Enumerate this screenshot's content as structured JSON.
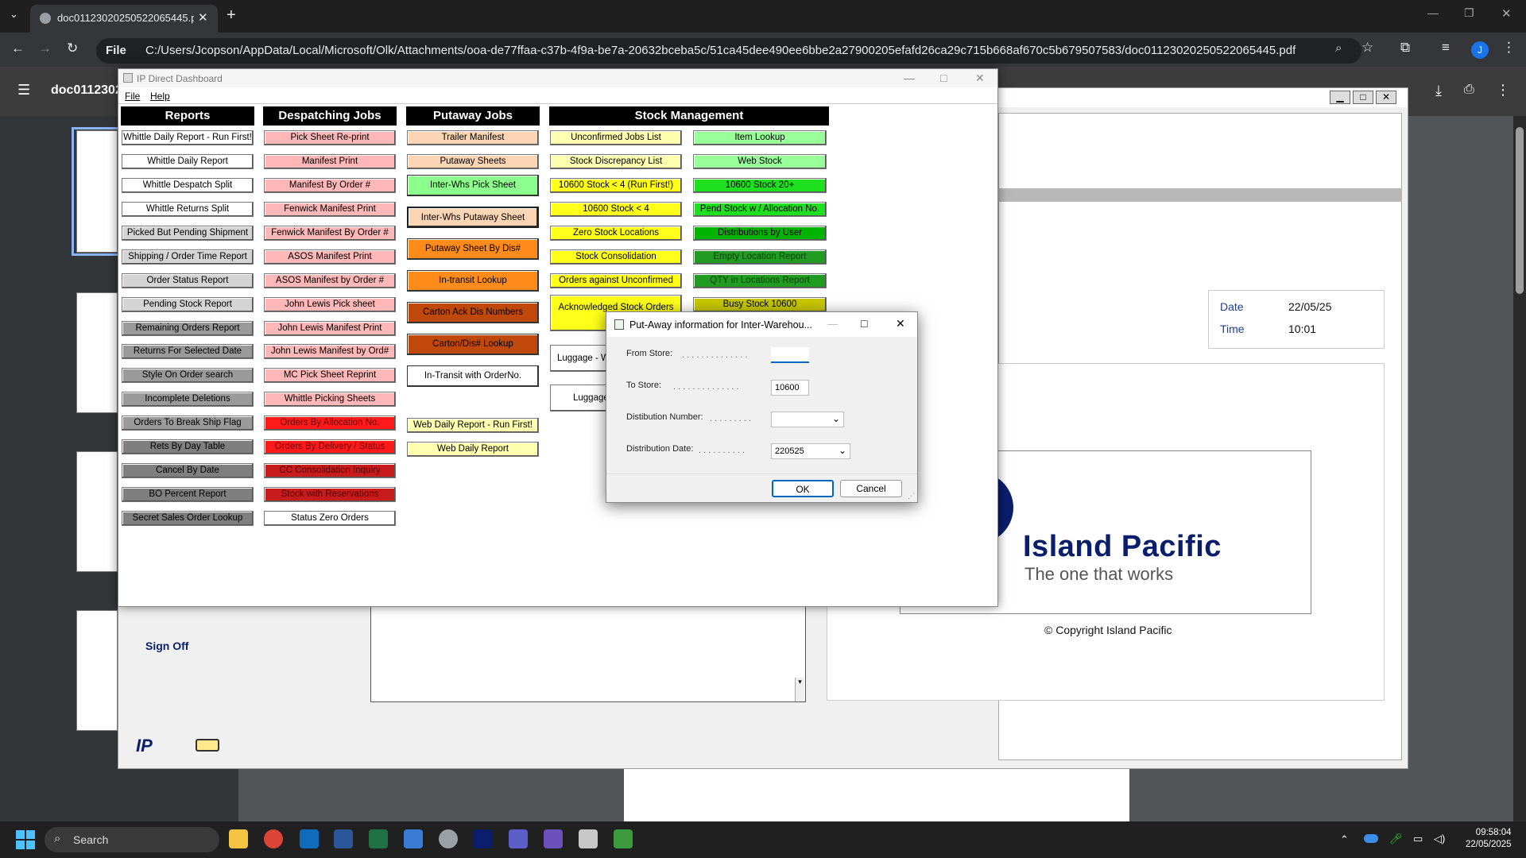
{
  "browser": {
    "tab_title": "doc01123020250522065445.pdf",
    "new_tab": "+",
    "scheme_label": "File",
    "url": "C:/Users/Jcopson/AppData/Local/Microsoft/Olk/Attachments/ooa-de77ffaa-c37b-4f9a-be7a-20632bceba5c/51ca45dee490ee6bbe2a27900205efafd26ca29c715b668af670c5b679507583/doc01123020250522065445.pdf",
    "profile_initial": "J"
  },
  "pdf_viewer": {
    "doc_name": "doc01123020"
  },
  "background_app": {
    "date_label": "Date",
    "date_value": "22/05/25",
    "time_label": "Time",
    "time_value": "10:01",
    "logo_name": "Island Pacific",
    "logo_tagline": "The one that works",
    "copyright": "© Copyright Island Pacific",
    "sign_off": "Sign Off",
    "small_logo": "IP"
  },
  "dashboard": {
    "title": "IP Direct Dashboard",
    "menu": [
      "File",
      "Help"
    ],
    "headers": {
      "reports": "Reports",
      "despatching": "Despatching Jobs",
      "putaway": "Putaway Jobs",
      "stock": "Stock Management"
    },
    "reports": [
      "Whittle Daily Report - Run First!",
      "Whittle Daily Report",
      "Whittle Despatch Split",
      "Whittle Returns Split",
      "Picked But Pending Shipment",
      "Shipping / Order Time Report",
      "Order Status Report",
      "Pending Stock Report",
      "Remaining Orders Report",
      "Returns For Selected Date",
      "Style On Order search",
      "Incomplete Deletions",
      "Orders To Break Ship Flag",
      "Rets By Day Table",
      "Cancel By Date",
      "BO Percent Report",
      "Secret Sales Order Lookup"
    ],
    "despatching": [
      "Pick Sheet Re-print",
      "Manifest Print",
      "Manifest By Order #",
      "Fenwick Manifest Print",
      "Fenwick Manifest By Order #",
      "ASOS Manifest Print",
      "ASOS Manifest by Order #",
      "John Lewis Pick sheet",
      "John Lewis Manifest Print",
      "John Lewis Manifest by Ord#",
      "MC Pick Sheet Reprint",
      "Whittle Picking Sheets",
      "Orders By Allocation No.",
      "Orders By Delivery / Status",
      "CC Consolidation Inquiry",
      "Stock with Reservations",
      "Status Zero Orders"
    ],
    "putaway": [
      "Trailer Manifest",
      "Putaway Sheets",
      "Inter-Whs Pick Sheet",
      "Inter-Whs Putaway Sheet",
      "Putaway Sheet By Dis#",
      "In-transit Lookup",
      "Carton Ack Dis Numbers",
      "Carton/Dis# Lookup",
      "In-Transit with OrderNo.",
      "Web Daily Report - Run First!",
      "Web Daily Report"
    ],
    "stock_left": [
      "Unconfirmed Jobs List",
      "Stock Discrepancy List",
      "10600 Stock < 4 (Run First!)",
      "10600 Stock < 4",
      "Zero Stock Locations",
      "Stock Consolidation",
      "Orders against Unconfirmed",
      "Acknowledged Stock Orders Re-...",
      "Luggage - W",
      "Luggage"
    ],
    "stock_right": [
      "Item Lookup",
      "Web Stock",
      "10600 Stock 20+",
      "Pend Stock w / Allocation No.",
      "Distributions by User",
      "Empty Location Report",
      "QTY in Locations Report",
      "Busy Stock 10600"
    ]
  },
  "dialog": {
    "title": "Put-Away information for Inter-Warehou...",
    "from_store_label": "From Store:",
    "from_store_value": "",
    "to_store_label": "To Store:",
    "to_store_value": "10600",
    "dist_number_label": "Distibution Number:",
    "dist_number_value": "",
    "dist_date_label": "Distribution Date:",
    "dist_date_value": "220525",
    "ok": "OK",
    "cancel": "Cancel",
    "leader_dots": ". . . . . . . . . . . . . ."
  },
  "taskbar": {
    "search": "Search",
    "time": "09:58:04",
    "date": "22/05/2025"
  }
}
